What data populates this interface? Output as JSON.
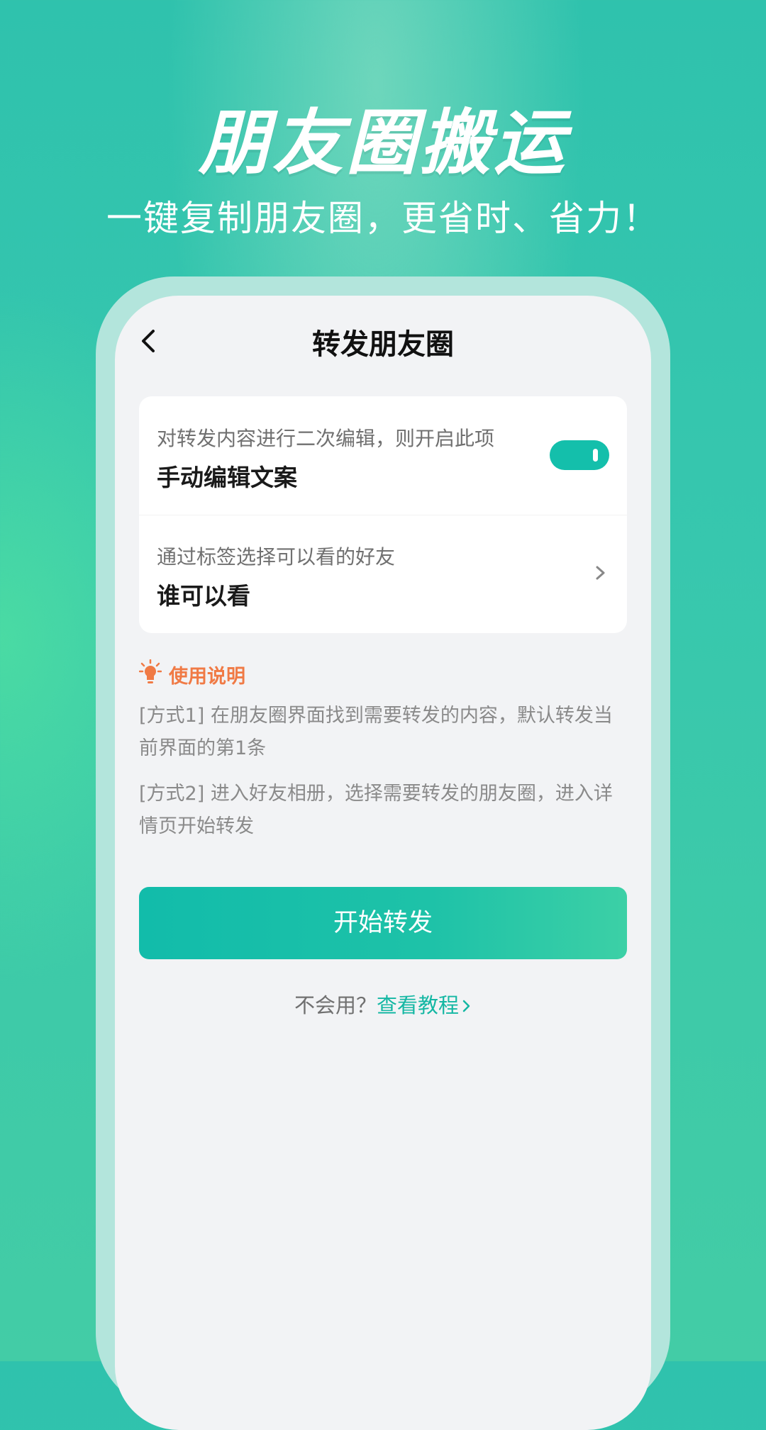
{
  "hero": {
    "title": "朋友圈搬运",
    "subtitle": "一键复制朋友圈，更省时、省力！"
  },
  "screen": {
    "nav_title": "转发朋友圈",
    "settings": [
      {
        "description": "对转发内容进行二次编辑，则开启此项",
        "label": "手动编辑文案",
        "control": "toggle",
        "enabled": true
      },
      {
        "description": "通过标签选择可以看的好友",
        "label": "谁可以看",
        "control": "chevron-right-icon"
      }
    ],
    "tips": {
      "icon": "lightbulb-icon",
      "title": "使用说明",
      "items": [
        "[方式1] 在朋友圈界面找到需要转发的内容，默认转发当前界面的第1条",
        "[方式2] 进入好友相册，选择需要转发的朋友圈，进入详情页开始转发"
      ]
    },
    "start_button": "开始转发",
    "help": {
      "question": "不会用？",
      "link": "查看教程"
    }
  },
  "colors": {
    "accent": "#14bfab",
    "tip_orange": "#f07a45",
    "background_green": "#37c7ae",
    "phone_frame": "#b3e5dc"
  }
}
